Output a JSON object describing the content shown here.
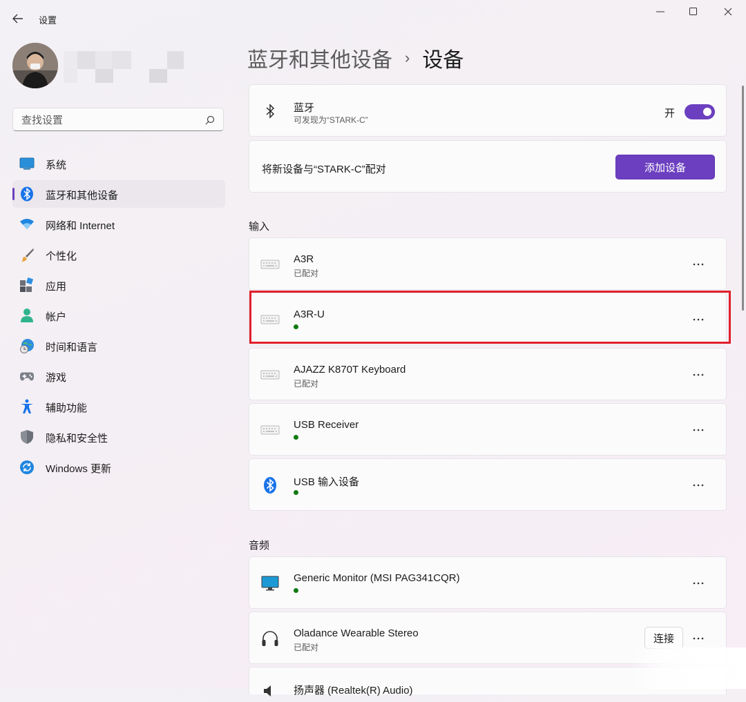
{
  "window": {
    "title": "设置",
    "controls": [
      "minimize",
      "maximize",
      "close"
    ]
  },
  "sidebar": {
    "search_placeholder": "查找设置",
    "items": [
      {
        "label": "系统",
        "icon": "system-icon",
        "active": false
      },
      {
        "label": "蓝牙和其他设备",
        "icon": "bluetooth-icon",
        "active": true
      },
      {
        "label": "网络和 Internet",
        "icon": "wifi-icon",
        "active": false
      },
      {
        "label": "个性化",
        "icon": "brush-icon",
        "active": false
      },
      {
        "label": "应用",
        "icon": "apps-icon",
        "active": false
      },
      {
        "label": "帐户",
        "icon": "account-icon",
        "active": false
      },
      {
        "label": "时间和语言",
        "icon": "globe-clock-icon",
        "active": false
      },
      {
        "label": "游戏",
        "icon": "gamepad-icon",
        "active": false
      },
      {
        "label": "辅助功能",
        "icon": "accessibility-icon",
        "active": false
      },
      {
        "label": "隐私和安全性",
        "icon": "shield-icon",
        "active": false
      },
      {
        "label": "Windows 更新",
        "icon": "update-icon",
        "active": false
      }
    ]
  },
  "breadcrumb": {
    "parent": "蓝牙和其他设备",
    "separator": "›",
    "current": "设备"
  },
  "bluetooth": {
    "title": "蓝牙",
    "subtitle": "可发现为“STARK-C”",
    "toggle_label": "开",
    "toggle_on": true
  },
  "pair": {
    "text": "将新设备与“STARK-C”配对",
    "button": "添加设备"
  },
  "sections": {
    "input": "输入",
    "audio": "音频"
  },
  "input_devices": [
    {
      "name": "A3R",
      "status": "已配对",
      "icon": "keyboard-icon"
    },
    {
      "name": "A3R-U",
      "status": "",
      "connected": true,
      "icon": "keyboard-icon"
    },
    {
      "name": "AJAZZ K870T Keyboard",
      "status": "已配对",
      "icon": "keyboard-icon"
    },
    {
      "name": "USB Receiver",
      "status": "",
      "connected": true,
      "icon": "keyboard-icon"
    },
    {
      "name": "USB 输入设备",
      "status": "",
      "connected": true,
      "icon": "bluetooth-icon"
    }
  ],
  "audio_devices": [
    {
      "name": "Generic Monitor (MSI PAG341CQR)",
      "status": "",
      "connected": true,
      "icon": "monitor-icon"
    },
    {
      "name": "Oladance Wearable Stereo",
      "status": "已配对",
      "icon": "headphones-icon",
      "connect_label": "连接"
    },
    {
      "name": "扬声器 (Realtek(R) Audio)",
      "status": "",
      "icon": "speaker-icon"
    }
  ],
  "colors": {
    "accent": "#6b3fbf",
    "connected": "#0f7b0f",
    "highlight": "#e0202c"
  }
}
